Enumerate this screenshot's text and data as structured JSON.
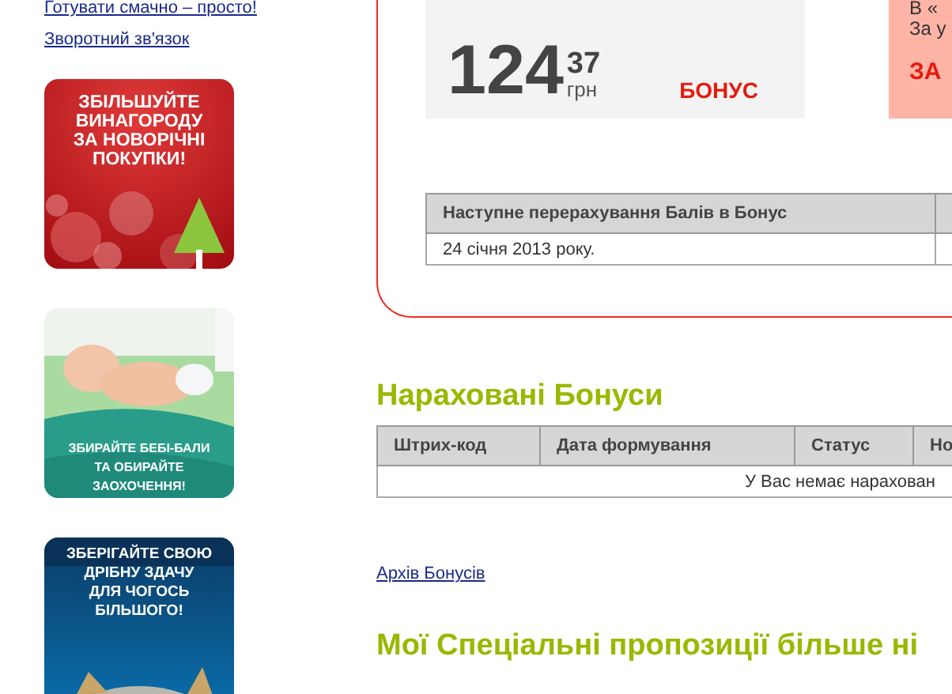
{
  "sidebar": {
    "links": [
      "Готувати смачно – просто!",
      "Зворотний зв'язок"
    ],
    "banners": [
      {
        "kind": "winter",
        "lines": [
          "ЗБІЛЬШУЙТЕ",
          "ВИНАГОРОДУ",
          "ЗА НОВОРІЧНІ",
          "ПОКУПКИ!"
        ]
      },
      {
        "kind": "baby",
        "lines": [
          "ЗБИРАЙТЕ БЕБІ-БАЛИ",
          "ТА ОБИРАЙТЕ",
          "ЗАОХОЧЕННЯ!"
        ]
      },
      {
        "kind": "coins",
        "lines": [
          "ЗБЕРІГАЙТЕ СВОЮ",
          "ДРІБНУ ЗДАЧУ",
          "ДЛЯ ЧОГОСЬ",
          "БІЛЬШОГО!"
        ]
      }
    ]
  },
  "balance": {
    "whole": "124",
    "fraction": "37",
    "currency": "грн",
    "label": "БОНУС"
  },
  "promo": {
    "lines": [
      "В «",
      "За у"
    ],
    "action": "ЗА"
  },
  "next_conversion": {
    "columns": [
      "Наступне перерахування Балів в Бонус"
    ],
    "rows": [
      [
        "24 січня 2013 року."
      ]
    ]
  },
  "accrued": {
    "title": "Нараховані Бонуси",
    "columns": [
      "Штрих-код",
      "Дата формування",
      "Статус",
      "Но"
    ],
    "empty_message": "У Вас немає нарахован"
  },
  "archive_link": "Архів Бонусів",
  "special_title": "Мої Спеціальні пропозиції більше ні"
}
